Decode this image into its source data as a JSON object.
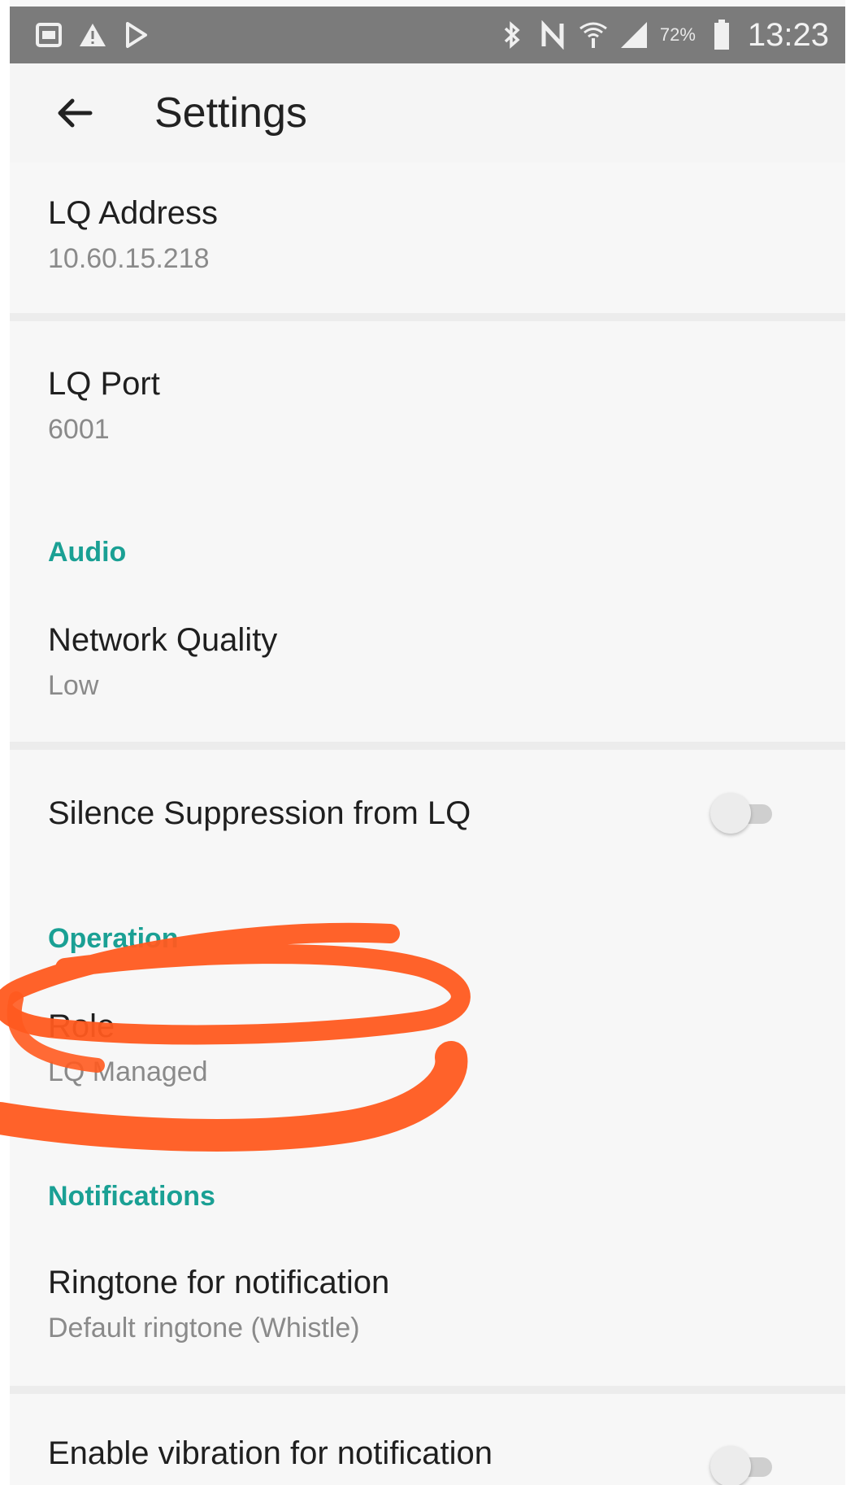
{
  "status_bar": {
    "battery": "72%",
    "time": "13:23"
  },
  "app_bar": {
    "title": "Settings"
  },
  "prefs": {
    "lq_address": {
      "title": "LQ Address",
      "summary": "10.60.15.218"
    },
    "lq_port": {
      "title": "LQ Port",
      "summary": "6001"
    },
    "audio_section": "Audio",
    "network_quality": {
      "title": "Network Quality",
      "summary": "Low"
    },
    "silence_suppression": {
      "title": "Silence Suppression from LQ",
      "enabled": false
    },
    "operation_section": "Operation",
    "role": {
      "title": "Role",
      "summary": "LQ Managed"
    },
    "notifications_section": "Notifications",
    "ringtone": {
      "title": "Ringtone for notification",
      "summary": "Default ringtone (Whistle)"
    },
    "vibration": {
      "title": "Enable vibration for notification",
      "enabled": false
    }
  },
  "colors": {
    "accent": "#1aa094",
    "annotation": "#ff5a1f"
  }
}
